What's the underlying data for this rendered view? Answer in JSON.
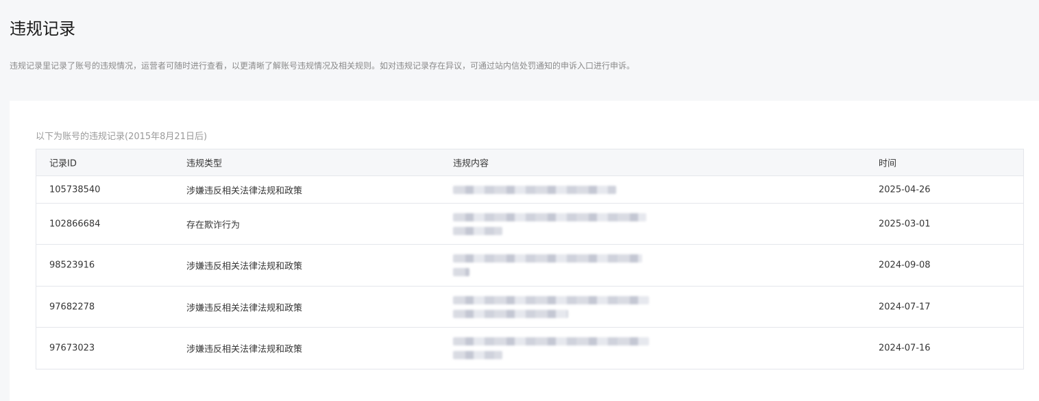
{
  "page": {
    "title": "违规记录",
    "description": "违规记录里记录了账号的违规情况，运营者可随时进行查看，以更清晰了解账号违规情况及相关规则。如对违规记录存在异议，可通过站内信处罚通知的申诉入口进行申诉。"
  },
  "card": {
    "caption": "以下为账号的违规记录(2015年8月21日后)"
  },
  "table": {
    "headers": {
      "id": "记录ID",
      "type": "违规类型",
      "content": "违规内容",
      "time": "时间"
    },
    "rows": [
      {
        "id": "105738540",
        "type": "涉嫌违反相关法律法规和政策",
        "time": "2025-04-26"
      },
      {
        "id": "102866684",
        "type": "存在欺诈行为",
        "time": "2025-03-01"
      },
      {
        "id": "98523916",
        "type": "涉嫌违反相关法律法规和政策",
        "time": "2024-09-08"
      },
      {
        "id": "97682278",
        "type": "涉嫌违反相关法律法规和政策",
        "time": "2024-07-17"
      },
      {
        "id": "97673023",
        "type": "涉嫌违反相关法律法规和政策",
        "time": "2024-07-16"
      }
    ]
  }
}
